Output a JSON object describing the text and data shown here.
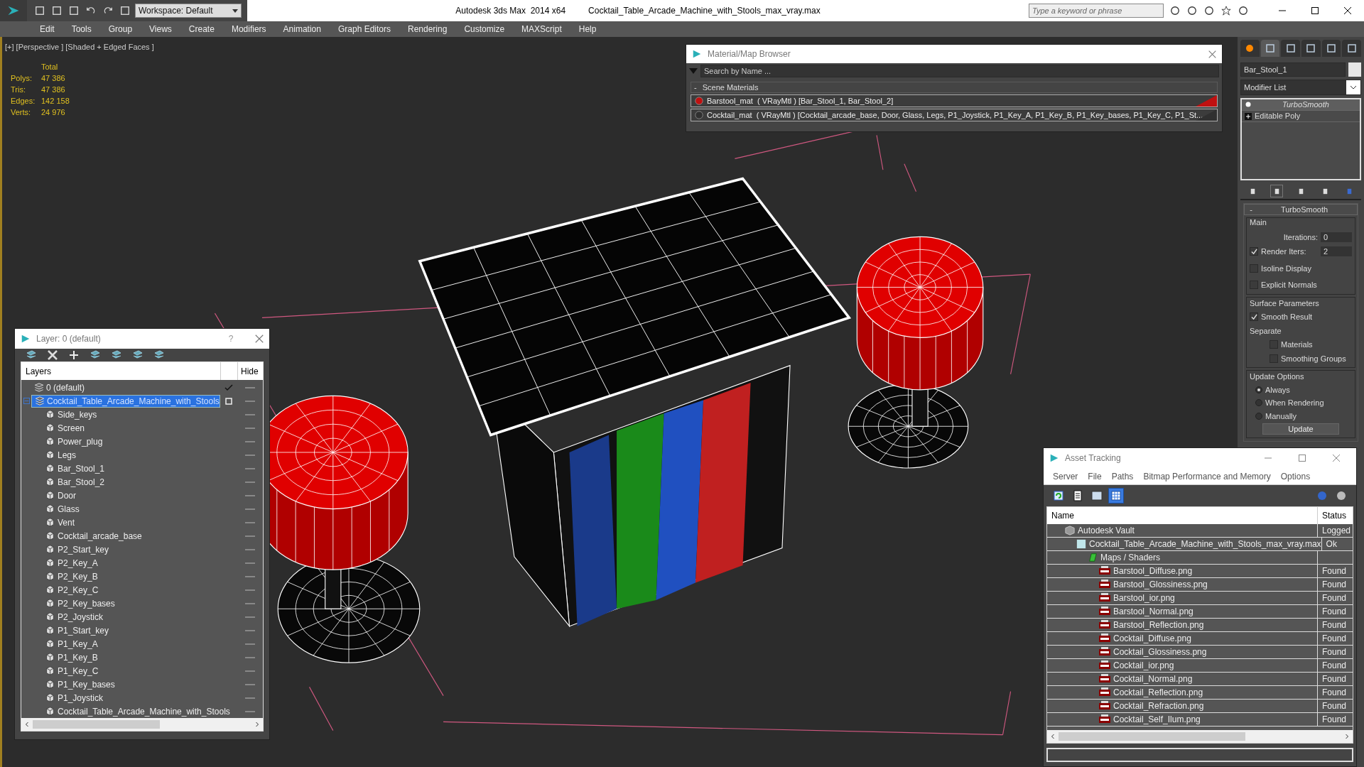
{
  "title_bar": {
    "workspace": "Workspace: Default",
    "app": "Autodesk 3ds Max  2014 x64",
    "file": "Cocktail_Table_Arcade_Machine_with_Stools_max_vray.max",
    "search_placeholder": "Type a keyword or phrase"
  },
  "menu": [
    "Edit",
    "Tools",
    "Group",
    "Views",
    "Create",
    "Modifiers",
    "Animation",
    "Graph Editors",
    "Rendering",
    "Customize",
    "MAXScript",
    "Help"
  ],
  "viewport": {
    "label": "[+] [Perspective ] [Shaded + Edged Faces ]",
    "stats_header": "Total",
    "stats": [
      {
        "label": "Polys:",
        "value": "47 386"
      },
      {
        "label": "Tris:",
        "value": "47 386"
      },
      {
        "label": "Edges:",
        "value": "142 158"
      },
      {
        "label": "Verts:",
        "value": "24 976"
      }
    ]
  },
  "material_browser": {
    "title": "Material/Map Browser",
    "search_placeholder": "Search by Name ...",
    "group_toggle": "-",
    "group": "Scene Materials",
    "materials": [
      {
        "text": "Barstool_mat  ( VRayMtl ) [Bar_Stool_1, Bar_Stool_2]",
        "color": "#c01010"
      },
      {
        "text": "Cocktail_mat  ( VRayMtl ) [Cocktail_arcade_base, Door, Glass, Legs, P1_Joystick, P1_Key_A, P1_Key_B, P1_Key_bases, P1_Key_C, P1_St...",
        "color": "#303030"
      }
    ]
  },
  "layer_window": {
    "title": "Layer: 0 (default)",
    "help": "?",
    "columns": [
      "Layers",
      "Hide"
    ],
    "layers": [
      {
        "name": "0 (default)",
        "current": true,
        "selected": false,
        "expanded": false
      },
      {
        "name": "Cocktail_Table_Arcade_Machine_with_Stools",
        "current": false,
        "selected": true,
        "expanded": true,
        "children": [
          {
            "name": "Side_keys"
          },
          {
            "name": "Screen"
          },
          {
            "name": "Power_plug"
          },
          {
            "name": "Legs"
          },
          {
            "name": "Bar_Stool_1"
          },
          {
            "name": "Bar_Stool_2"
          },
          {
            "name": "Door"
          },
          {
            "name": "Glass"
          },
          {
            "name": "Vent"
          },
          {
            "name": "Cocktail_arcade_base"
          },
          {
            "name": "P2_Start_key"
          },
          {
            "name": "P2_Key_A"
          },
          {
            "name": "P2_Key_B"
          },
          {
            "name": "P2_Key_C"
          },
          {
            "name": "P2_Key_bases"
          },
          {
            "name": "P2_Joystick"
          },
          {
            "name": "P1_Start_key"
          },
          {
            "name": "P1_Key_A"
          },
          {
            "name": "P1_Key_B"
          },
          {
            "name": "P1_Key_C"
          },
          {
            "name": "P1_Key_bases"
          },
          {
            "name": "P1_Joystick"
          },
          {
            "name": "Cocktail_Table_Arcade_Machine_with_Stools"
          }
        ]
      }
    ]
  },
  "command_panel": {
    "object_name": "Bar_Stool_1",
    "modifier_list": "Modifier List",
    "stack": [
      {
        "name": "TurboSmooth",
        "kind": "modifier",
        "selected": true
      },
      {
        "name": "Editable Poly",
        "kind": "base",
        "selected": false
      }
    ],
    "rollout_toggle": "-",
    "rollout": "TurboSmooth",
    "main_title": "Main",
    "iterations_label": "Iterations:",
    "iterations": "0",
    "render_iters_label": "Render Iters:",
    "render_iters_checked": true,
    "render_iters": "2",
    "main_checks": [
      {
        "label": "Isoline Display",
        "checked": false
      },
      {
        "label": "Explicit Normals",
        "checked": false
      }
    ],
    "surface_title": "Surface Parameters",
    "smooth_result": {
      "label": "Smooth Result",
      "checked": true
    },
    "separate": "Separate",
    "separate_checks": [
      {
        "label": "Materials",
        "checked": false
      },
      {
        "label": "Smoothing Groups",
        "checked": false
      }
    ],
    "update_title": "Update Options",
    "update_options": [
      {
        "label": "Always",
        "selected": true
      },
      {
        "label": "When Rendering",
        "selected": false
      },
      {
        "label": "Manually",
        "selected": false
      }
    ],
    "update_button": "Update"
  },
  "asset_tracking": {
    "title": "Asset Tracking",
    "menu": [
      "Server",
      "File",
      "Paths",
      "Bitmap Performance and Memory",
      "Options"
    ],
    "columns": [
      "Name",
      "Status"
    ],
    "rows": [
      {
        "name": "Autodesk Vault",
        "status": "Logged",
        "kind": "vault",
        "children": [
          {
            "name": "Cocktail_Table_Arcade_Machine_with_Stools_max_vray.max",
            "status": "Ok",
            "kind": "scene",
            "children": [
              {
                "name": "Maps / Shaders",
                "kind": "maps",
                "children": [
                  {
                    "name": "Barstool_Diffuse.png",
                    "status": "Found",
                    "kind": "png"
                  },
                  {
                    "name": "Barstool_Glossiness.png",
                    "status": "Found",
                    "kind": "png"
                  },
                  {
                    "name": "Barstool_ior.png",
                    "status": "Found",
                    "kind": "png"
                  },
                  {
                    "name": "Barstool_Normal.png",
                    "status": "Found",
                    "kind": "png"
                  },
                  {
                    "name": "Barstool_Reflection.png",
                    "status": "Found",
                    "kind": "png"
                  },
                  {
                    "name": "Cocktail_Diffuse.png",
                    "status": "Found",
                    "kind": "png"
                  },
                  {
                    "name": "Cocktail_Glossiness.png",
                    "status": "Found",
                    "kind": "png"
                  },
                  {
                    "name": "Cocktail_ior.png",
                    "status": "Found",
                    "kind": "png"
                  },
                  {
                    "name": "Cocktail_Normal.png",
                    "status": "Found",
                    "kind": "png"
                  },
                  {
                    "name": "Cocktail_Reflection.png",
                    "status": "Found",
                    "kind": "png"
                  },
                  {
                    "name": "Cocktail_Refraction.png",
                    "status": "Found",
                    "kind": "png"
                  },
                  {
                    "name": "Cocktail_Self_Ilum.png",
                    "status": "Found",
                    "kind": "png"
                  }
                ]
              }
            ]
          }
        ]
      }
    ]
  }
}
